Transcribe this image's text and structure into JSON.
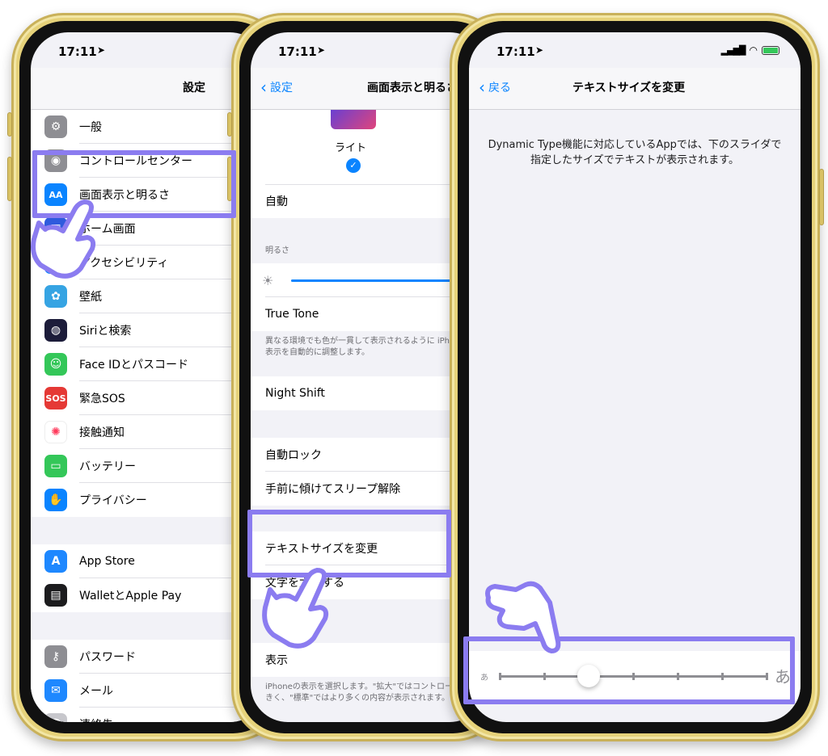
{
  "status": {
    "time": "17:11",
    "location_icon": "location-arrow-icon"
  },
  "screen1": {
    "title": "設定",
    "group1": [
      {
        "label": "一般",
        "icon": "gear-icon",
        "color": "#8e8e93"
      },
      {
        "label": "コントロールセンター",
        "icon": "control-center-icon",
        "color": "#8e8e93"
      },
      {
        "label": "画面表示と明るさ",
        "icon": "display-icon",
        "color": "#0a84ff"
      },
      {
        "label": "ホーム画面",
        "icon": "home-screen-icon",
        "color": "#2f5bdd"
      },
      {
        "label": "アクセシビリティ",
        "icon": "accessibility-icon",
        "color": "#0a84ff"
      },
      {
        "label": "壁紙",
        "icon": "wallpaper-icon",
        "color": "#36a4e3"
      },
      {
        "label": "Siriと検索",
        "icon": "siri-icon",
        "color": "#1c1c3a"
      },
      {
        "label": "Face IDとパスコード",
        "icon": "face-id-icon",
        "color": "#34c759"
      },
      {
        "label": "緊急SOS",
        "icon": "sos-icon",
        "color": "#e53935"
      },
      {
        "label": "接触通知",
        "icon": "exposure-icon",
        "color": "#ffffff"
      },
      {
        "label": "バッテリー",
        "icon": "battery-icon",
        "color": "#34c759"
      },
      {
        "label": "プライバシー",
        "icon": "hand-icon",
        "color": "#0a84ff"
      }
    ],
    "group2": [
      {
        "label": "App Store",
        "icon": "app-store-icon",
        "color": "#1e88ff"
      },
      {
        "label": "WalletとApple Pay",
        "icon": "wallet-icon",
        "color": "#1c1c1e"
      }
    ],
    "group3": [
      {
        "label": "パスワード",
        "icon": "key-icon",
        "color": "#8e8e93"
      },
      {
        "label": "メール",
        "icon": "mail-icon",
        "color": "#1e88ff"
      },
      {
        "label": "連絡先",
        "icon": "contacts-icon",
        "color": "#c7c7cc"
      }
    ],
    "sos_text": "SOS"
  },
  "screen2": {
    "back": "設定",
    "title": "画面表示と明るさ",
    "appearance_label": "ライト",
    "auto": "自動",
    "brightness_header": "明るさ",
    "brightness_level": 0.9,
    "true_tone": "True Tone",
    "true_tone_note": "異なる環境でも色が一貫して表示されるように iPhoneの表示を自動的に調整します。",
    "night_shift": "Night Shift",
    "auto_lock": "自動ロック",
    "raise_to_wake": "手前に傾けてスリープ解除",
    "text_size": "テキストサイズを変更",
    "bold_text": "文字を太くする",
    "display": "表示",
    "display_note": "iPhoneの表示を選択します。\"拡大\"ではコントロールが大きく、\"標準\"ではより多くの内容が表示されます。"
  },
  "screen3": {
    "back": "戻る",
    "title": "テキストサイズを変更",
    "description": "Dynamic Type機能に対応しているAppでは、下のスライダで指定したサイズでテキストが表示されます。",
    "small_glyph": "あ",
    "large_glyph": "あ",
    "slider_steps": 7,
    "slider_value_step": 3,
    "accent": "#8b7cf0"
  }
}
